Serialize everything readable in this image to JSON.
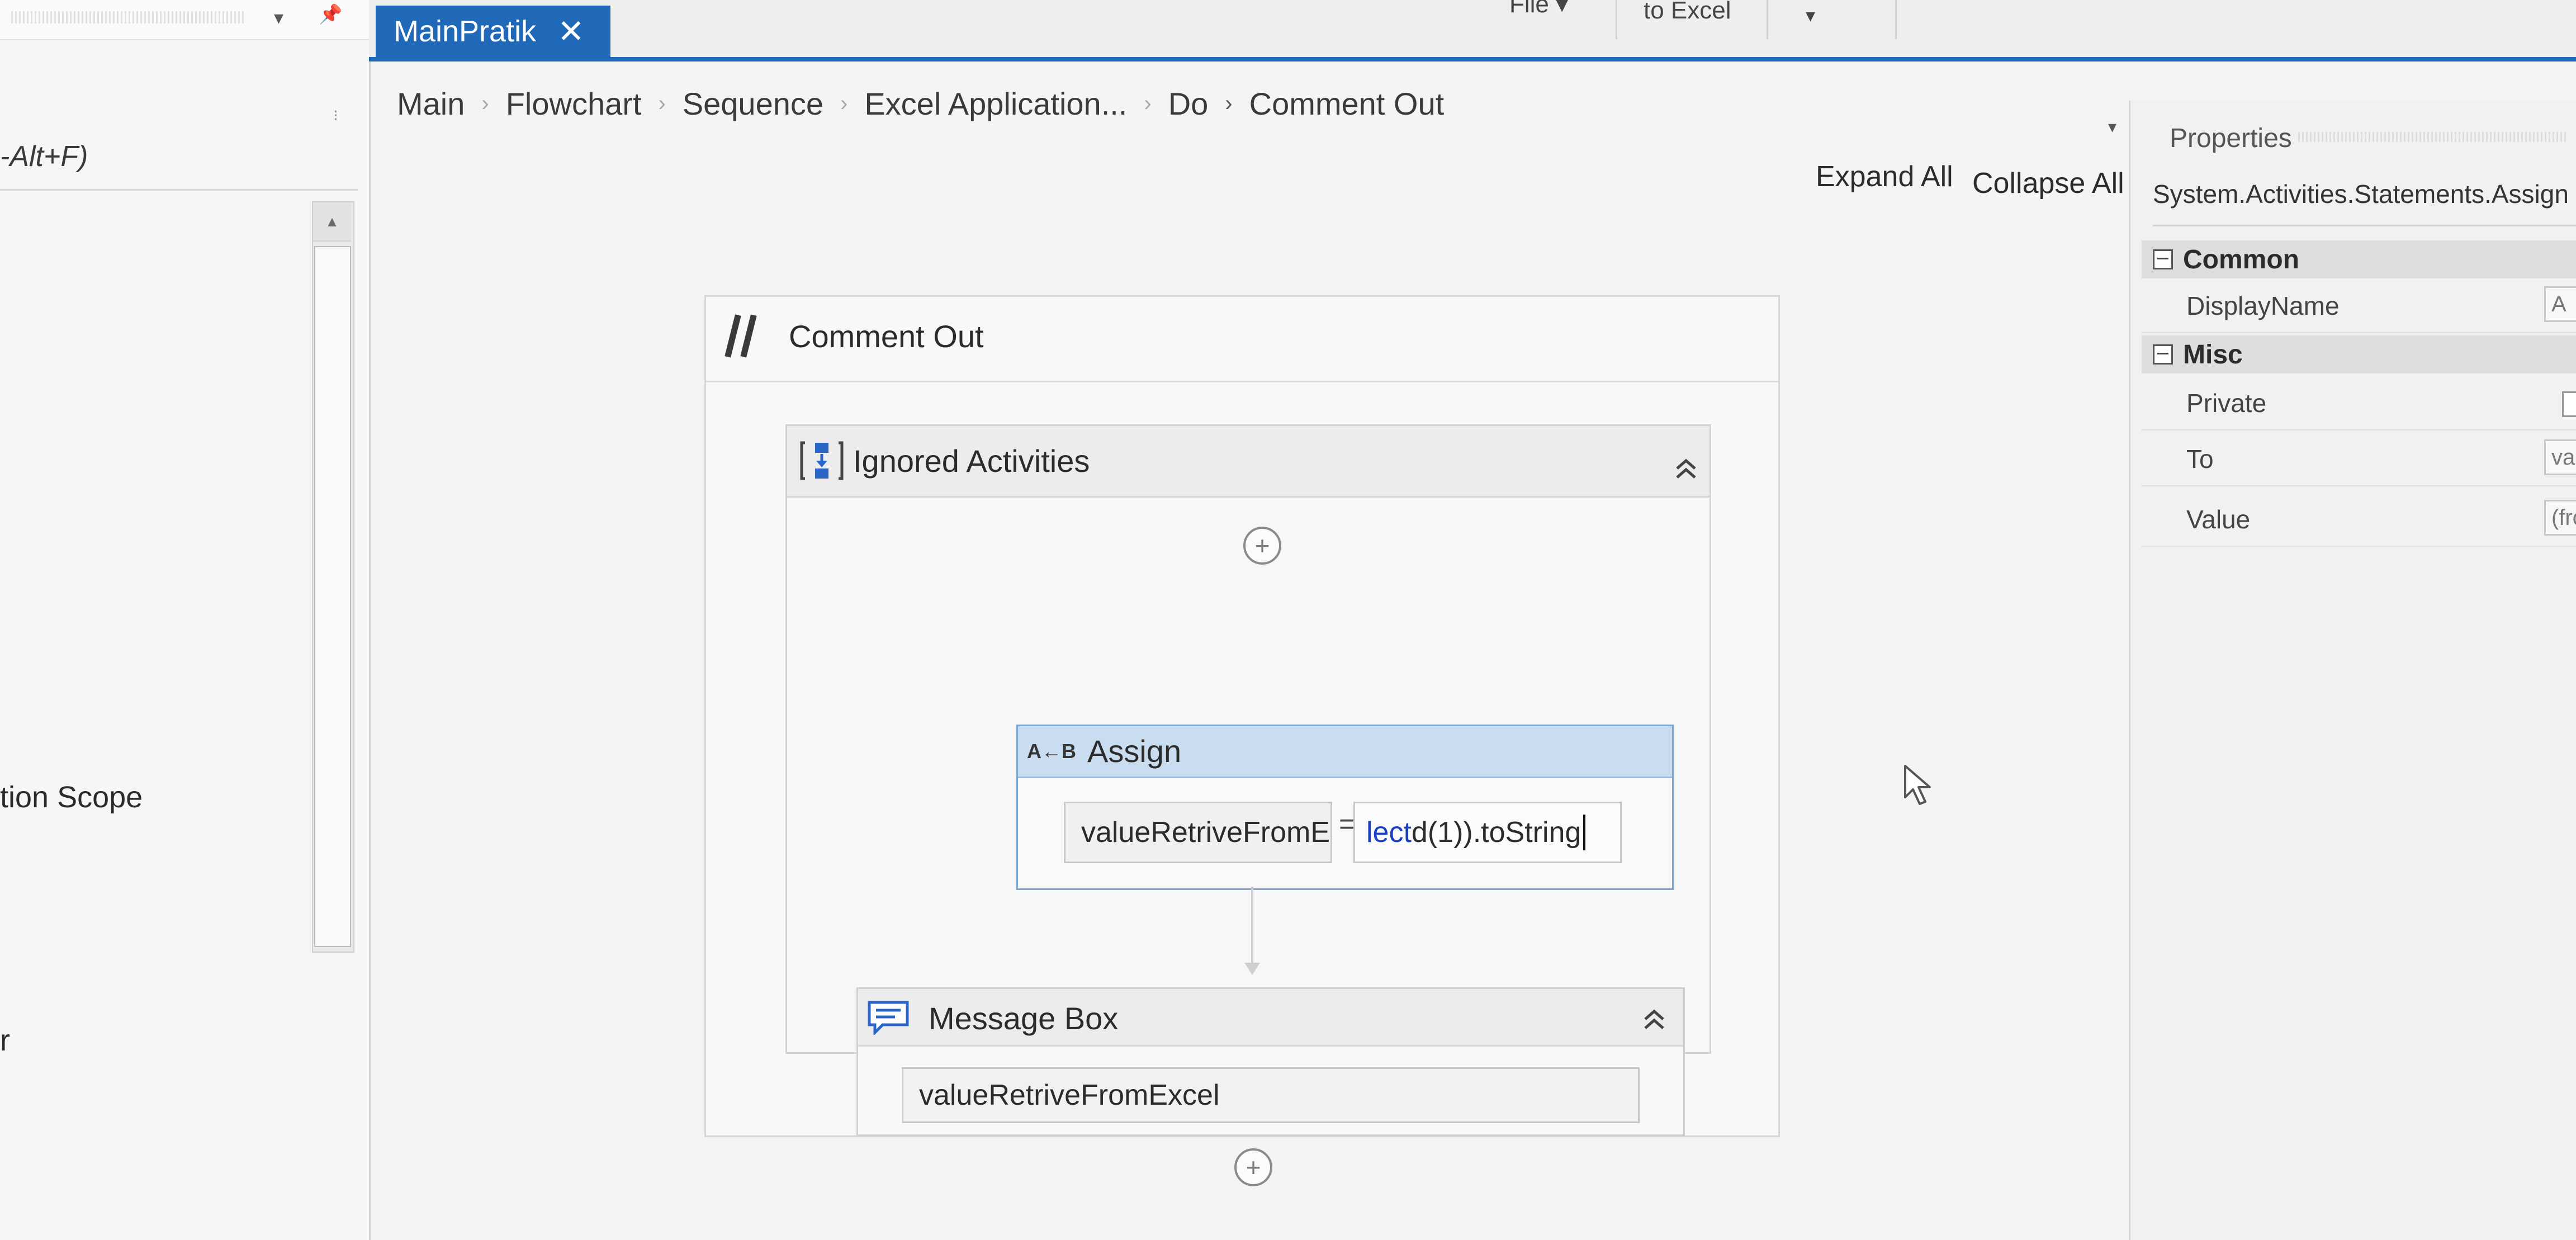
{
  "left_panel": {
    "shortcut_text": "-Alt+F)",
    "item_text": "tion Scope",
    "item_text_2": "r"
  },
  "ribbon": {
    "file_label": "File ▾",
    "to_excel_label": "to Excel"
  },
  "tab": {
    "title": "MainPratik",
    "close_glyph": "✕"
  },
  "breadcrumb": {
    "items": [
      "Main",
      "Flowchart",
      "Sequence",
      "Excel Application...",
      "Do",
      "Comment Out"
    ],
    "separator": "›"
  },
  "designer": {
    "expand_all": "Expand All",
    "collapse_all": "Collapse All",
    "comment_out": {
      "title": "Comment Out",
      "icon": "comment-slashes-icon"
    },
    "ignored": {
      "title": "Ignored Activities",
      "icon": "sequence-icon"
    },
    "assign": {
      "icon_text": "A←B",
      "title": "Assign",
      "to_value": "valueRetriveFromE",
      "equals": "=",
      "value_keyword": "lect",
      "value_rest": " d(1)).toString"
    },
    "message_box": {
      "icon": "message-box-icon",
      "title": "Message Box",
      "text_value": "valueRetriveFromExcel"
    },
    "add_glyph": "+"
  },
  "properties": {
    "title": "Properties",
    "type_name": "System.Activities.Statements.Assign",
    "categories": [
      {
        "name": "Common",
        "rows": [
          {
            "name": "DisplayName",
            "value": "A"
          }
        ]
      },
      {
        "name": "Misc",
        "rows": [
          {
            "name": "Private",
            "value": ""
          },
          {
            "name": "To",
            "value": "va"
          },
          {
            "name": "Value",
            "value": "(fro"
          }
        ]
      }
    ]
  },
  "colors": {
    "tab_blue": "#1f69b8",
    "assign_header": "#c9dcf0",
    "keyword_blue": "#1a3fc4"
  }
}
